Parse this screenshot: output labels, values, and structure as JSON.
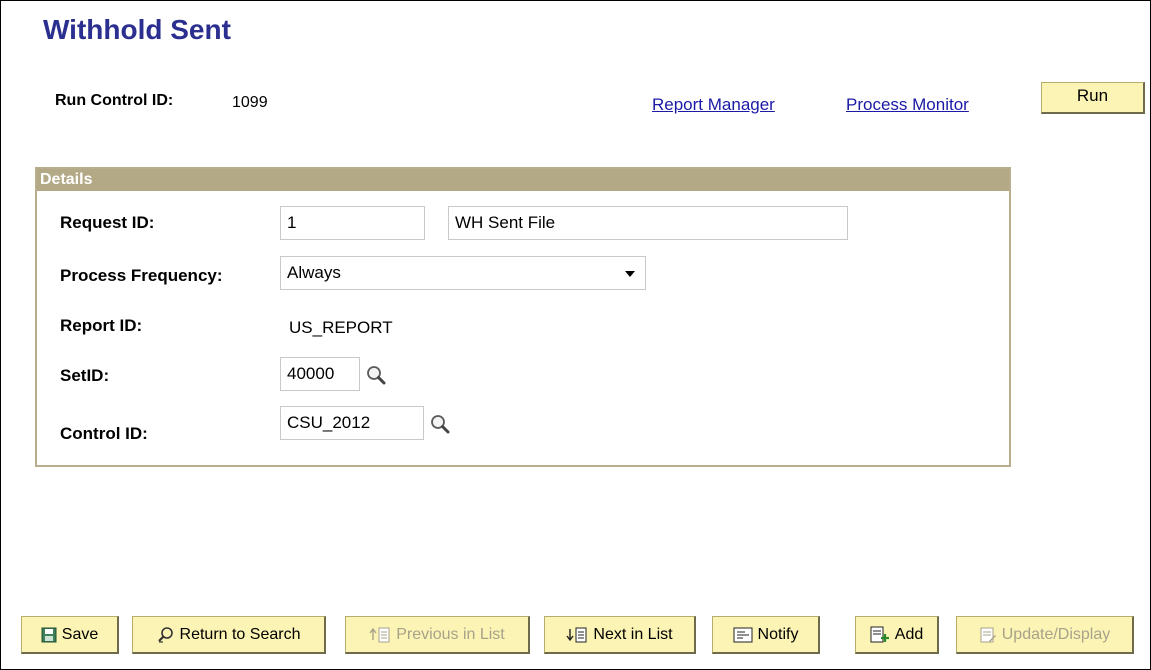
{
  "page": {
    "title": "Withhold Sent"
  },
  "run_control": {
    "label": "Run Control ID:",
    "value": "1099"
  },
  "links": {
    "report_manager": "Report Manager",
    "process_monitor": "Process Monitor"
  },
  "run_button": "Run",
  "details": {
    "header": "Details",
    "request_id_label": "Request ID:",
    "request_id_value": "1",
    "request_description": "WH Sent File",
    "process_frequency_label": "Process Frequency:",
    "process_frequency_value": "Always",
    "report_id_label": "Report ID:",
    "report_id_value": "US_REPORT",
    "setid_label": "SetID:",
    "setid_value": "40000",
    "control_id_label": "Control ID:",
    "control_id_value": "CSU_2012"
  },
  "toolbar": {
    "save": "Save",
    "return_to_search": "Return to Search",
    "previous_in_list": "Previous in List",
    "next_in_list": "Next in List",
    "notify": "Notify",
    "add": "Add",
    "update_display": "Update/Display"
  },
  "colors": {
    "title": "#2b2f8f",
    "link": "#1a1aa6",
    "button_bg": "#fcf4b4",
    "details_header": "#b3a986",
    "disabled_text": "#a7a28a"
  },
  "icons": {
    "lookup": "magnifier-icon",
    "save": "floppy-disk-icon",
    "return_to_search": "search-return-icon",
    "previous_in_list": "previous-list-icon",
    "next_in_list": "next-list-icon",
    "notify": "notify-icon",
    "add": "add-icon",
    "update_display": "update-display-icon"
  }
}
